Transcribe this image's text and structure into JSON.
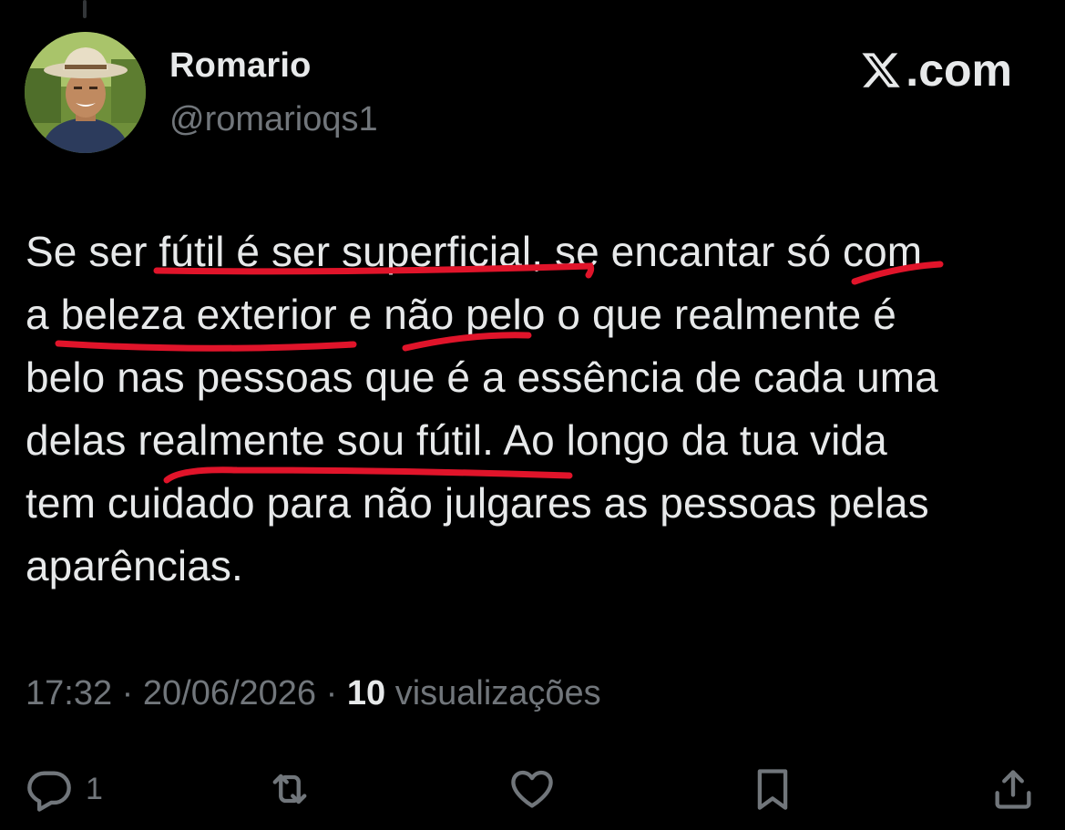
{
  "tweet": {
    "display_name": "Romario",
    "handle": "@romarioqs1",
    "brand": ".com",
    "lines": [
      "Se ser fútil é ser superficial, se encantar só com",
      "a beleza exterior e não pelo o que realmente é",
      "belo nas pessoas que é a essência de cada uma",
      "delas realmente sou fútil. Ao longo da tua vida",
      "tem cuidado para não julgares as pessoas pelas",
      "aparências."
    ],
    "time": "17:32",
    "separator": " · ",
    "date": "20/06/2026",
    "views_count": "10",
    "views_label": "visualizações"
  },
  "actions": {
    "reply_count": "1"
  },
  "icons": {
    "reply": "reply-icon",
    "retweet": "retweet-icon",
    "like": "heart-icon",
    "bookmark": "bookmark-icon",
    "share": "share-icon",
    "brand": "x-logo-icon"
  },
  "colors": {
    "background": "#000000",
    "text": "#e7e9ea",
    "secondary": "#71767b",
    "underline": "#e0142a"
  }
}
